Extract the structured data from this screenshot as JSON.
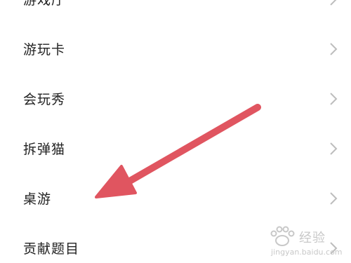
{
  "menu": {
    "items": [
      {
        "label": "游戏厅",
        "icon": "chevron-right-icon"
      },
      {
        "label": "游玩卡",
        "icon": "chevron-right-icon"
      },
      {
        "label": "会玩秀",
        "icon": "chevron-right-icon"
      },
      {
        "label": "拆弹猫",
        "icon": "chevron-right-icon"
      },
      {
        "label": "桌游",
        "icon": "chevron-right-icon"
      },
      {
        "label": "贡献题目",
        "icon": "chevron-right-icon"
      }
    ]
  },
  "annotation": {
    "arrow_color": "#e05560",
    "points_to": "桌游"
  },
  "watermark": {
    "text": "经验",
    "url": "jingyan.baidu.com"
  },
  "colors": {
    "background": "#ffffff",
    "text": "#222222",
    "chevron": "#bdbdbd"
  }
}
